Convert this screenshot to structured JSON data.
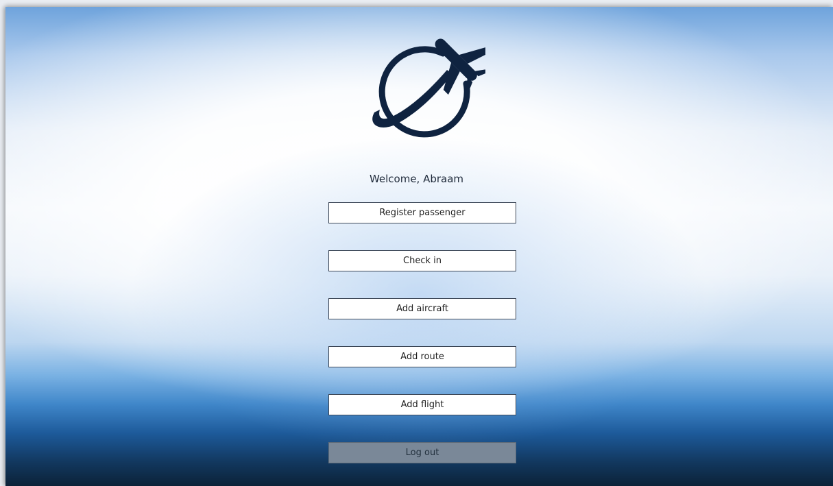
{
  "app": {
    "logo_icon": "plane-globe-logo-icon",
    "welcome_text": "Welcome, Abraam"
  },
  "menu": {
    "buttons": [
      {
        "id": "register-passenger",
        "label": "Register passenger"
      },
      {
        "id": "check-in",
        "label": "Check in"
      },
      {
        "id": "add-aircraft",
        "label": "Add aircraft"
      },
      {
        "id": "add-route",
        "label": "Add route"
      },
      {
        "id": "add-flight",
        "label": "Add flight"
      },
      {
        "id": "log-out",
        "label": "Log out"
      }
    ]
  },
  "colors": {
    "logo": "#0f2340",
    "button_bg": "#ffffff",
    "logout_bg": "#7a8898",
    "text": "#1f2a3a"
  }
}
